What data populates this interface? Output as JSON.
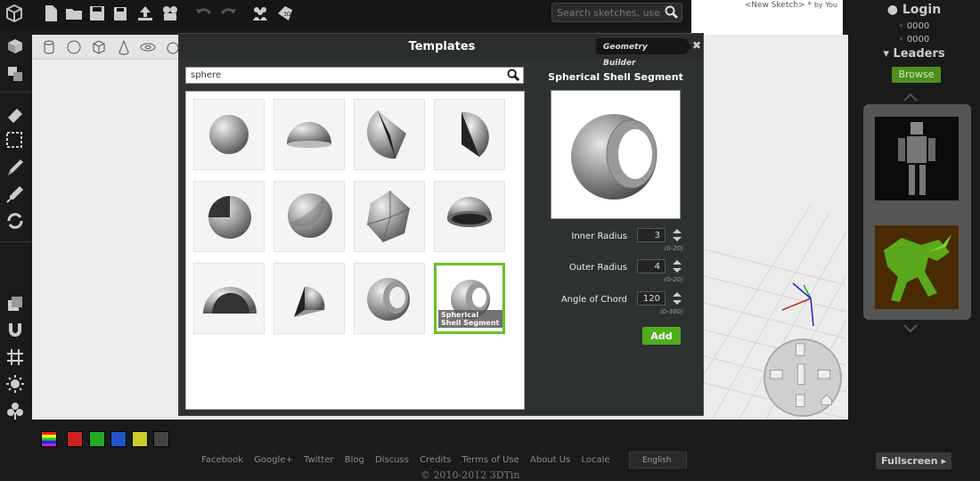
{
  "toolbar": {
    "search_placeholder": "Search sketches, users...",
    "sketch_title": "<New Sketch>",
    "sketch_marker": "*",
    "sketch_by": "by You"
  },
  "user": {
    "login_label": "Login",
    "points_1": "0000",
    "points_2": "0000",
    "leaders_label": "Leaders",
    "browse_label": "Browse"
  },
  "modal": {
    "title": "Templates",
    "geometry_builder_label": "Geometry Builder",
    "close_glyph": "✖",
    "search_value": "sphere",
    "tiles": [
      {
        "shape": "sphere"
      },
      {
        "shape": "hemisphere"
      },
      {
        "shape": "sphere-wedge"
      },
      {
        "shape": "sphere-slice"
      },
      {
        "shape": "sphere-cut-quarter"
      },
      {
        "shape": "sphere-cut"
      },
      {
        "shape": "sphere-polyhedron"
      },
      {
        "shape": "hemispherical-bowl"
      },
      {
        "shape": "hemispherical-shell"
      },
      {
        "shape": "sphere-octant"
      },
      {
        "shape": "shell-segment-small"
      },
      {
        "shape": "spherical-shell-segment",
        "caption": "Spherical Shell Segment",
        "selected": true
      }
    ],
    "detail": {
      "title": "Spherical Shell Segment",
      "params": [
        {
          "label": "Inner Radius",
          "value": "3",
          "range": "(0-20)"
        },
        {
          "label": "Outer Radius",
          "value": "4",
          "range": "(0-20)"
        },
        {
          "label": "Angle of Chord",
          "value": "120",
          "range": "(0-360)"
        }
      ],
      "add_label": "Add"
    }
  },
  "palette": {
    "colors": [
      "#cc2222",
      "#22aa22",
      "#2255cc",
      "#cccc22",
      "#444444"
    ]
  },
  "footer": {
    "links": [
      "Facebook",
      "Google+",
      "Twitter",
      "Blog",
      "Discuss",
      "Credits",
      "Terms of Use",
      "About Us",
      "Locale"
    ],
    "locale_value": "English",
    "copyright": "© 2010-2012 3DTin",
    "fullscreen_label": "Fullscreen"
  }
}
